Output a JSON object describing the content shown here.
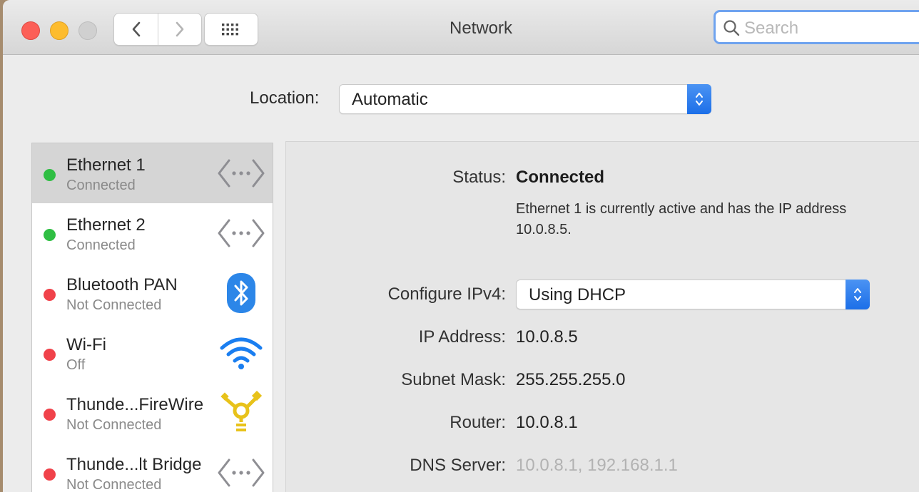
{
  "window": {
    "title": "Network"
  },
  "toolbar": {
    "search_placeholder": "Search"
  },
  "location": {
    "label": "Location:",
    "value": "Automatic"
  },
  "services": [
    {
      "name": "Ethernet 1",
      "status": "Connected",
      "status_color": "#2fbe43",
      "icon": "ethernet-icon",
      "selected": true
    },
    {
      "name": "Ethernet 2",
      "status": "Connected",
      "status_color": "#2fbe43",
      "icon": "ethernet-icon",
      "selected": false
    },
    {
      "name": "Bluetooth PAN",
      "status": "Not Connected",
      "status_color": "#f0424a",
      "icon": "bluetooth-icon",
      "selected": false
    },
    {
      "name": "Wi-Fi",
      "status": "Off",
      "status_color": "#f0424a",
      "icon": "wifi-icon",
      "selected": false
    },
    {
      "name": "Thunde...FireWire",
      "status": "Not Connected",
      "status_color": "#f0424a",
      "icon": "firewire-icon",
      "selected": false
    },
    {
      "name": "Thunde...lt Bridge",
      "status": "Not Connected",
      "status_color": "#f0424a",
      "icon": "ethernet-icon",
      "selected": false
    }
  ],
  "detail": {
    "status_label": "Status:",
    "status_value": "Connected",
    "status_desc": "Ethernet 1 is currently active and has the IP address 10.0.8.5.",
    "configure_label": "Configure IPv4:",
    "configure_value": "Using DHCP",
    "ip_label": "IP Address:",
    "ip_value": "10.0.8.5",
    "subnet_label": "Subnet Mask:",
    "subnet_value": "255.255.255.0",
    "router_label": "Router:",
    "router_value": "10.0.8.1",
    "dns_label": "DNS Server:",
    "dns_value": "10.0.8.1, 192.168.1.1"
  },
  "colors": {
    "accent": "#1c6fe8",
    "connected": "#2fbe43",
    "disconnected": "#f0424a",
    "search_focus": "#6fa3ef"
  }
}
